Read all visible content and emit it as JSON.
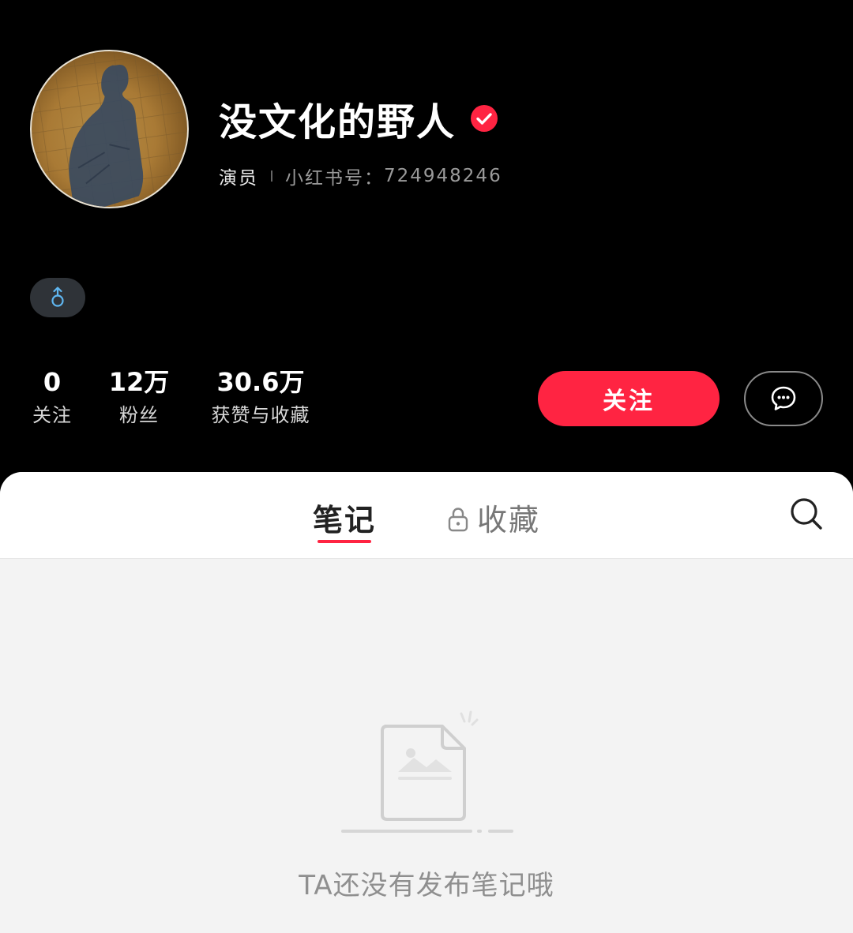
{
  "profile": {
    "username": "没文化的野人",
    "role": "演员",
    "id_label": "小红书号：",
    "id_value": "724948246",
    "gender_symbol": "male-icon"
  },
  "stats": [
    {
      "value": "0",
      "label": "关注"
    },
    {
      "value": "12万",
      "label": "粉丝"
    },
    {
      "value": "30.6万",
      "label": "获赞与收藏"
    }
  ],
  "actions": {
    "follow_label": "关注",
    "message_icon": "chat-bubble-icon"
  },
  "tabs": {
    "notes_label": "笔记",
    "collections_label": "收藏",
    "collections_icon": "lock-icon",
    "search_icon": "search-icon"
  },
  "empty_state": {
    "message": "TA还没有发布笔记哦",
    "icon": "empty-document-icon"
  },
  "colors": {
    "accent": "#ff2442",
    "background": "#000000",
    "panel": "#f3f3f3"
  }
}
